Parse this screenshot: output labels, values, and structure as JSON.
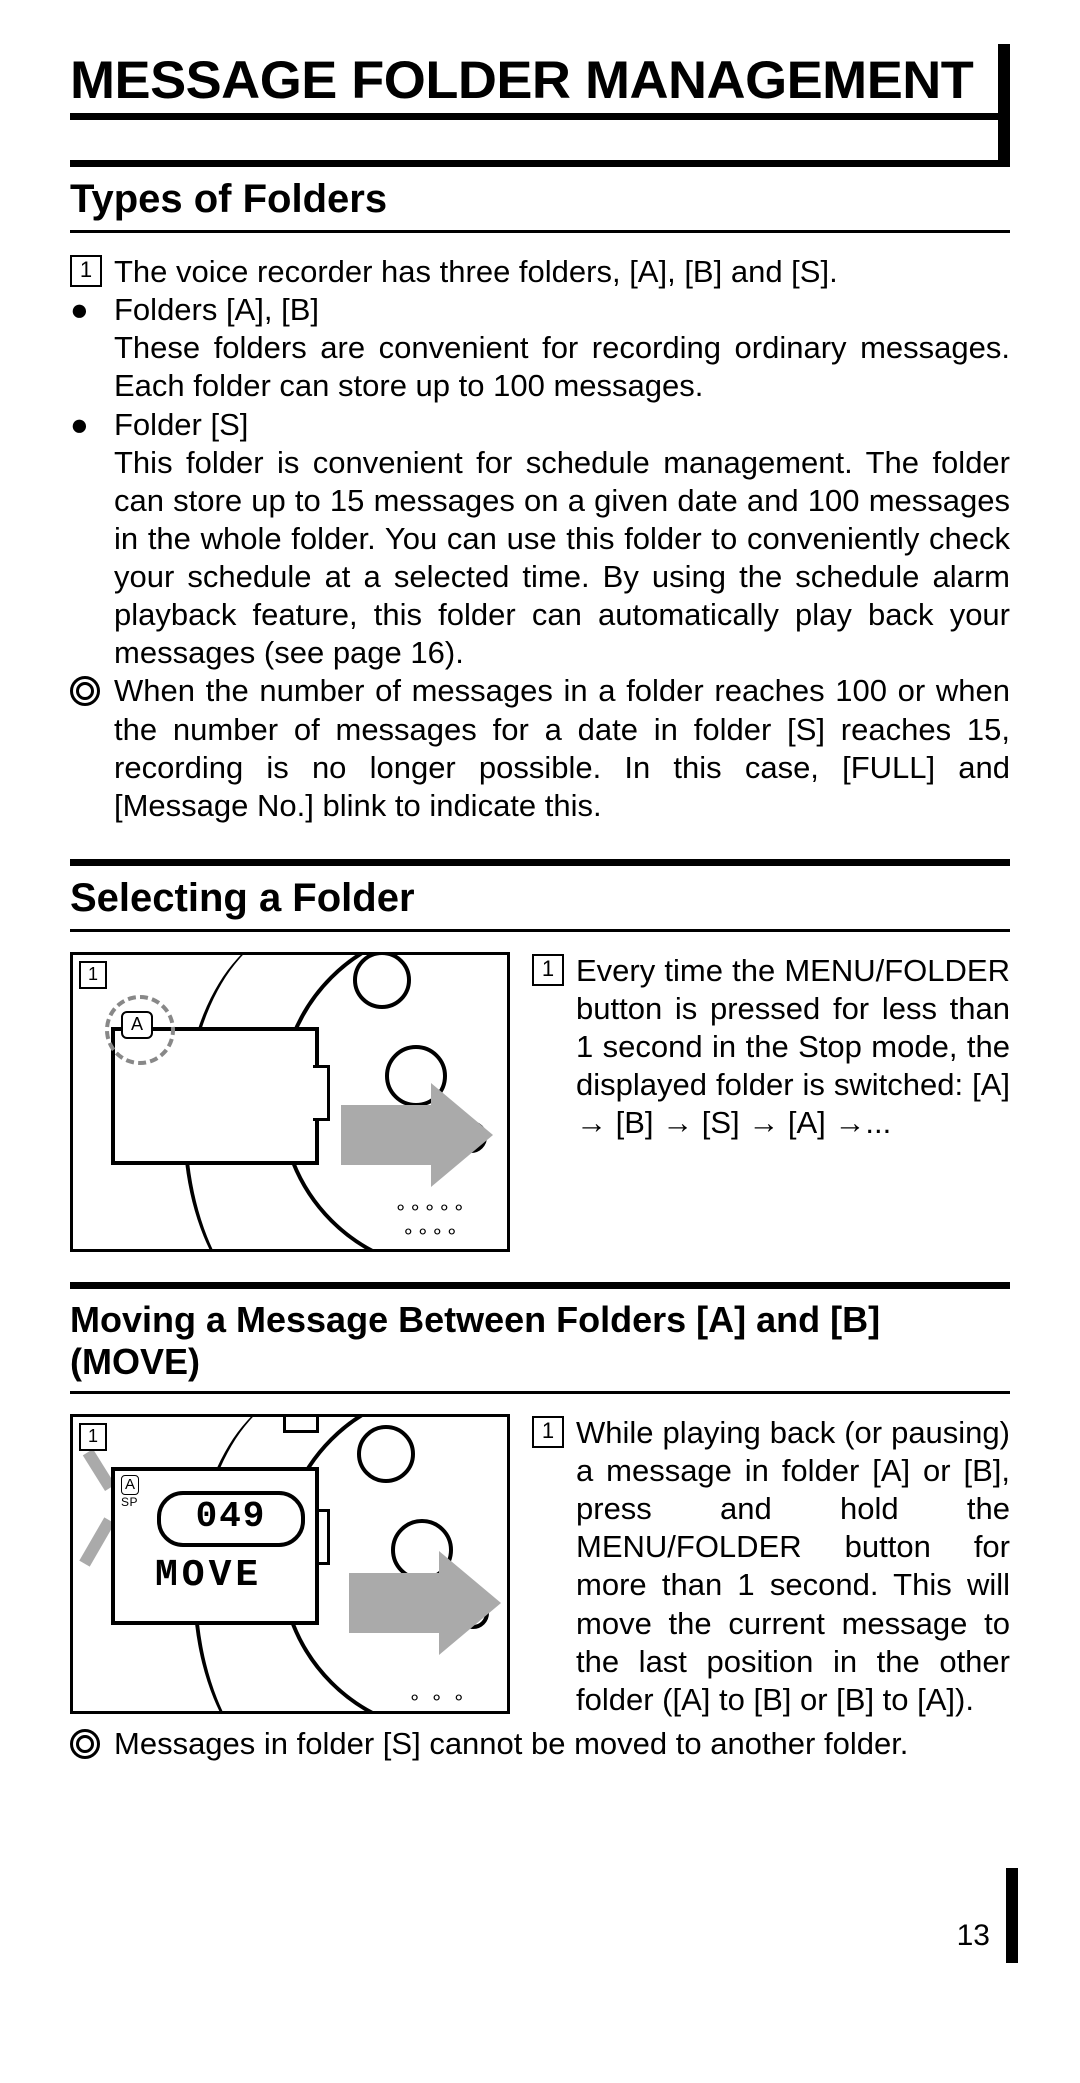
{
  "title": "MESSAGE FOLDER MANAGEMENT",
  "page_number": "13",
  "sections": {
    "types": {
      "heading": "Types of Folders",
      "step1_num": "1",
      "step1_text": "The voice recorder has three folders, [A], [B] and [S].",
      "bullet_ab_title": "Folders [A], [B]",
      "bullet_ab_body": "These folders are convenient for recording ordinary messages. Each folder can store up to 100 messages.",
      "bullet_s_title": "Folder [S]",
      "bullet_s_body": "This folder is convenient for schedule management. The folder can store up to 15 messages on a given date and 100 messages in the whole folder. You can use this folder to conveniently check your schedule at a selected time. By using the schedule alarm playback feature, this folder can automatically play back your messages (see page 16).",
      "note_text": "When the number of messages in a folder reaches 100 or when the number of messages for a date in folder [S] reaches 15, recording is no longer possible. In this case, [FULL] and [Message No.] blink to indicate this."
    },
    "selecting": {
      "heading": "Selecting a Folder",
      "step1_num": "1",
      "step1_text": "Every time the MENU/FOLDER button is pressed for less than 1 second in the Stop mode, the displayed folder is switched: [A] → [B] → [S] → [A] →...",
      "fig_stepnum": "1",
      "fig_badge_a": "A"
    },
    "moving": {
      "heading": "Moving a Message Between Folders [A] and [B]  (MOVE)",
      "step1_num": "1",
      "step1_text": "While playing back (or pausing) a message in folder [A] or [B], press and hold the MENU/FOLDER button for more than 1 second. This will move the current message to the last position in the other folder ([A] to [B] or [B] to [A]).",
      "note_text": "Messages in folder [S] cannot be moved to another folder.",
      "fig_stepnum": "1",
      "fig_lcd_a": "A",
      "fig_lcd_sp": "SP",
      "fig_lcd_num": "049",
      "fig_lcd_move": "MOVE"
    }
  }
}
